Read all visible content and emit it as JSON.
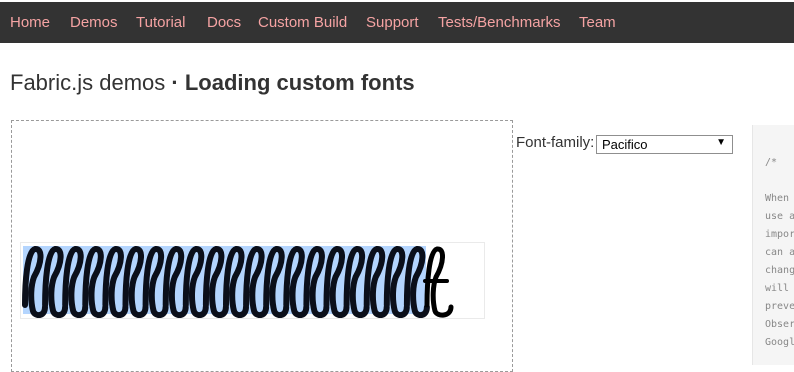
{
  "nav": {
    "items": [
      "Home",
      "Demos",
      "Tutorial",
      "Docs",
      "Custom Build",
      "Support",
      "Tests/Benchmarks",
      "Team"
    ]
  },
  "title": {
    "prefix": "Fabric.js demos",
    "separator": "·",
    "main": "Loading custom fonts"
  },
  "canvas": {
    "text_glyph": "f",
    "glyph_count": 21,
    "selected_count": 20
  },
  "controls": {
    "font_label": "Font-family:",
    "font_value": "Pacifico",
    "arrow": "▼"
  },
  "code": {
    "lines": [
      "/*",
      "",
      "When",
      "use a",
      "impor",
      "can a",
      "chang",
      "will",
      "preve",
      "Obser",
      "Googl"
    ]
  },
  "colors": {
    "navbar_bg": "#333333",
    "nav_link": "#f5a3a3",
    "selection": "#b4d5fe",
    "code_bg": "#f5f5f5"
  }
}
